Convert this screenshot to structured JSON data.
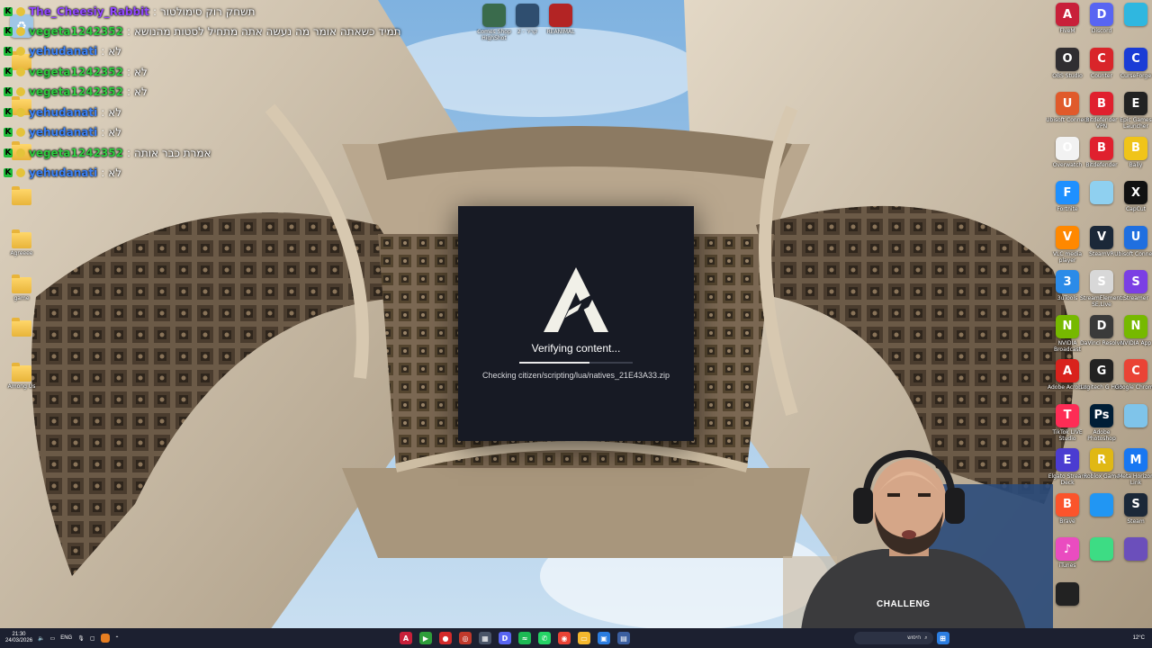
{
  "colors": {
    "dialog_bg": "#171a24",
    "taskbar_bg": "#1c2030",
    "chat_green": "#1fbd39",
    "user_purple": "#9146ff",
    "user_green": "#2ecc40",
    "user_blue": "#3b82f6"
  },
  "chat": {
    "lines": [
      {
        "user": "The_Cheesiy_Rabbit",
        "color": "#9146ff",
        "message": "תשחק רוק סימולטור"
      },
      {
        "user": "vegeta1242352",
        "color": "#2ecc40",
        "message": "תמיד כשאתה אומר מה נעשה אתה מתחיל לסטות מהנושא"
      },
      {
        "user": "yehudanati",
        "color": "#3b82f6",
        "message": "לא"
      },
      {
        "user": "vegeta1242352",
        "color": "#2ecc40",
        "message": "לא"
      },
      {
        "user": "vegeta1242352",
        "color": "#2ecc40",
        "message": "לא"
      },
      {
        "user": "yehudanati",
        "color": "#3b82f6",
        "message": "לא"
      },
      {
        "user": "yehudanati",
        "color": "#3b82f6",
        "message": "לא"
      },
      {
        "user": "vegeta1242352",
        "color": "#2ecc40",
        "message": "אמרת כבר אותה"
      },
      {
        "user": "yehudanati",
        "color": "#3b82f6",
        "message": "לא"
      }
    ],
    "separator": ":",
    "tag_letter": "K"
  },
  "desktop_left": [
    {
      "label": "",
      "icon": "recycle-bin-icon"
    },
    {
      "label": "",
      "icon": "folder-icon"
    },
    {
      "label": "",
      "icon": "folder-icon"
    },
    {
      "label": "",
      "icon": "folder-icon"
    },
    {
      "label": "",
      "icon": "folder-icon"
    },
    {
      "label": "Agreeee",
      "icon": "folder-icon"
    },
    {
      "label": "game",
      "icon": "folder-icon"
    },
    {
      "label": "",
      "icon": "folder-icon"
    },
    {
      "label": "Among Us",
      "icon": "folder-icon"
    }
  ],
  "desktop_top": [
    {
      "label": "Comes Shop HighShot",
      "color": "#3a6b4c"
    },
    {
      "label": "קריר - 2",
      "color": "#2f4e6f"
    },
    {
      "label": "REANIMAL",
      "color": "#b32424"
    }
  ],
  "desktop_right": [
    {
      "label": "FiveM",
      "letter": "A",
      "color": "#c8203a"
    },
    {
      "label": "Discord",
      "letter": "D",
      "color": "#5865f2"
    },
    {
      "label": "",
      "letter": "",
      "color": "#2fb7e0"
    },
    {
      "label": "OBS Studio",
      "letter": "O",
      "color": "#302e31"
    },
    {
      "label": "Counter",
      "letter": "C",
      "color": "#d9252a"
    },
    {
      "label": "CurseForge",
      "letter": "C",
      "color": "#1a3cd6"
    },
    {
      "label": "Ubisoft Connect",
      "letter": "U",
      "color": "#e05a2b"
    },
    {
      "label": "Bitdefender VPN",
      "letter": "B",
      "color": "#e0202e"
    },
    {
      "label": "Epic Games Launcher",
      "letter": "E",
      "color": "#222222"
    },
    {
      "label": "Overwatch",
      "letter": "O",
      "color": "#f2f2f2"
    },
    {
      "label": "Bitdefender",
      "letter": "B",
      "color": "#e0202e"
    },
    {
      "label": "Bally",
      "letter": "B",
      "color": "#f0c419"
    },
    {
      "label": "Fortnite",
      "letter": "F",
      "color": "#1e90ff"
    },
    {
      "label": "",
      "letter": "",
      "color": "#8fd0f0"
    },
    {
      "label": "CapCut",
      "letter": "X",
      "color": "#111111"
    },
    {
      "label": "VLC media player",
      "letter": "V",
      "color": "#ff8800"
    },
    {
      "label": "SteamVR",
      "letter": "V",
      "color": "#1b2838"
    },
    {
      "label": "Ubisoft Connect",
      "letter": "U",
      "color": "#1f6fe0"
    },
    {
      "label": "3uTools",
      "letter": "3",
      "color": "#2b8be8"
    },
    {
      "label": "StreamElements SE.Live",
      "letter": "S",
      "color": "#d8d8d8"
    },
    {
      "label": "Streamer",
      "letter": "S",
      "color": "#7b3fe4"
    },
    {
      "label": "NVIDIA Broadcast",
      "letter": "N",
      "color": "#76b900"
    },
    {
      "label": "DaVinci Resolve",
      "letter": "D",
      "color": "#3a3a3a"
    },
    {
      "label": "NVIDIA App",
      "letter": "N",
      "color": "#76b900"
    },
    {
      "label": "Adobe Acrobat",
      "letter": "A",
      "color": "#d9221c"
    },
    {
      "label": "Logitech G HUB",
      "letter": "G",
      "color": "#222222"
    },
    {
      "label": "Google Chrome",
      "letter": "C",
      "color": "#ea4335"
    },
    {
      "label": "TikTok LIVE Studio",
      "letter": "T",
      "color": "#fe2c55"
    },
    {
      "label": "Adobe Photoshop",
      "letter": "Ps",
      "color": "#001e36"
    },
    {
      "label": "",
      "letter": "",
      "color": "#7fc4ea"
    },
    {
      "label": "Elgato Stream Deck",
      "letter": "E",
      "color": "#4b3cd1"
    },
    {
      "label": "Roblox Game",
      "letter": "R",
      "color": "#e0b814"
    },
    {
      "label": "Meta Horizon Link",
      "letter": "M",
      "color": "#1877f2"
    },
    {
      "label": "Brave",
      "letter": "B",
      "color": "#fb542b"
    },
    {
      "label": "",
      "letter": "",
      "color": "#2196f3"
    },
    {
      "label": "Steam",
      "letter": "S",
      "color": "#1b2838"
    },
    {
      "label": "iTunes",
      "letter": "♪",
      "color": "#ea4cc0"
    },
    {
      "label": "",
      "letter": "",
      "color": "#3ddc84"
    },
    {
      "label": "",
      "letter": "",
      "color": "#6b4fbb"
    },
    {
      "label": "",
      "letter": "",
      "color": "#222222"
    }
  ],
  "dialog": {
    "status": "Verifying content...",
    "detail": "Checking citizen/scripting/lua/natives_21E43A33.zip",
    "progress": 0.62
  },
  "webcam": {
    "shirt_text": "CHALLENG"
  },
  "taskbar": {
    "time": "21:30",
    "date": "24/03/2026",
    "lang": "ENG",
    "search_placeholder": "חיפוש",
    "temperature": "12°C",
    "apps": [
      {
        "name": "fivem-taskbar-icon",
        "color": "#c8203a",
        "letter": "A"
      },
      {
        "name": "media-player-taskbar-icon",
        "color": "#2e9e3a",
        "letter": "▶"
      },
      {
        "name": "record-taskbar-icon",
        "color": "#d42b2b",
        "letter": "●"
      },
      {
        "name": "app-red-taskbar-icon",
        "color": "#c0392b",
        "letter": "◎"
      },
      {
        "name": "calculator-taskbar-icon",
        "color": "#4a5568",
        "letter": "▦"
      },
      {
        "name": "discord-taskbar-icon",
        "color": "#5865f2",
        "letter": "D"
      },
      {
        "name": "spotify-taskbar-icon",
        "color": "#1db954",
        "letter": "≈"
      },
      {
        "name": "whatsapp-taskbar-icon",
        "color": "#25d366",
        "letter": "✆"
      },
      {
        "name": "chrome-taskbar-icon",
        "color": "#ea4335",
        "letter": "◉"
      },
      {
        "name": "explorer-taskbar-icon",
        "color": "#f5b82e",
        "letter": "▭"
      },
      {
        "name": "photos-taskbar-icon",
        "color": "#2b7de0",
        "letter": "▣"
      },
      {
        "name": "monitor-taskbar-icon",
        "color": "#3b5fa0",
        "letter": "▤"
      }
    ]
  }
}
